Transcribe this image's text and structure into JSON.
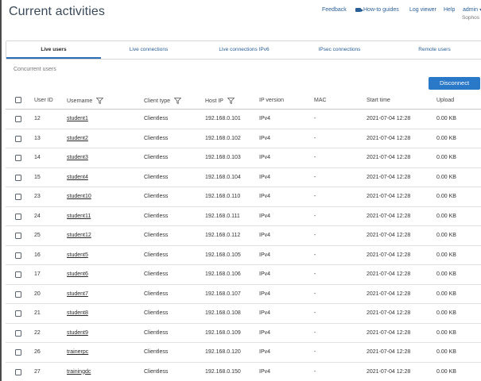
{
  "header": {
    "title": "Current activities",
    "links": {
      "feedback": "Feedback",
      "howto": "How-to guides",
      "logviewer": "Log viewer",
      "help": "Help",
      "admin": "admin"
    },
    "org": "Sophos"
  },
  "tabs": [
    {
      "label": "Live users",
      "active": true
    },
    {
      "label": "Live connections",
      "active": false
    },
    {
      "label": "Live connections IPv6",
      "active": false
    },
    {
      "label": "IPsec connections",
      "active": false
    },
    {
      "label": "Remote users",
      "active": false
    }
  ],
  "section": {
    "label": "Concurrent users"
  },
  "actions": {
    "disconnect": "Disconnect"
  },
  "columns": {
    "user_id": "User ID",
    "username": "Username",
    "client_type": "Client type",
    "host_ip": "Host IP",
    "ip_version": "IP version",
    "mac": "MAC",
    "start_time": "Start time",
    "upload": "Upload"
  },
  "rows": [
    {
      "id": "12",
      "username": "student1",
      "client": "Clientless",
      "ip": "192.168.0.101",
      "ipver": "IPv4",
      "mac": "-",
      "start": "2021-07-04 12:28",
      "upload": "0.00 KB"
    },
    {
      "id": "13",
      "username": "student2",
      "client": "Clientless",
      "ip": "192.168.0.102",
      "ipver": "IPv4",
      "mac": "-",
      "start": "2021-07-04 12:28",
      "upload": "0.00 KB"
    },
    {
      "id": "14",
      "username": "student3",
      "client": "Clientless",
      "ip": "192.168.0.103",
      "ipver": "IPv4",
      "mac": "-",
      "start": "2021-07-04 12:28",
      "upload": "0.00 KB"
    },
    {
      "id": "15",
      "username": "student4",
      "client": "Clientless",
      "ip": "192.168.0.104",
      "ipver": "IPv4",
      "mac": "-",
      "start": "2021-07-04 12:28",
      "upload": "0.00 KB"
    },
    {
      "id": "23",
      "username": "student10",
      "client": "Clientless",
      "ip": "192.168.0.110",
      "ipver": "IPv4",
      "mac": "-",
      "start": "2021-07-04 12:28",
      "upload": "0.00 KB"
    },
    {
      "id": "24",
      "username": "student11",
      "client": "Clientless",
      "ip": "192.168.0.111",
      "ipver": "IPv4",
      "mac": "-",
      "start": "2021-07-04 12:28",
      "upload": "0.00 KB"
    },
    {
      "id": "25",
      "username": "student12",
      "client": "Clientless",
      "ip": "192.168.0.112",
      "ipver": "IPv4",
      "mac": "-",
      "start": "2021-07-04 12:28",
      "upload": "0.00 KB"
    },
    {
      "id": "16",
      "username": "student5",
      "client": "Clientless",
      "ip": "192.168.0.105",
      "ipver": "IPv4",
      "mac": "-",
      "start": "2021-07-04 12:28",
      "upload": "0.00 KB"
    },
    {
      "id": "17",
      "username": "student6",
      "client": "Clientless",
      "ip": "192.168.0.106",
      "ipver": "IPv4",
      "mac": "-",
      "start": "2021-07-04 12:28",
      "upload": "0.00 KB"
    },
    {
      "id": "20",
      "username": "student7",
      "client": "Clientless",
      "ip": "192.168.0.107",
      "ipver": "IPv4",
      "mac": "-",
      "start": "2021-07-04 12:28",
      "upload": "0.00 KB"
    },
    {
      "id": "21",
      "username": "student8",
      "client": "Clientless",
      "ip": "192.168.0.108",
      "ipver": "IPv4",
      "mac": "-",
      "start": "2021-07-04 12:28",
      "upload": "0.00 KB"
    },
    {
      "id": "22",
      "username": "student9",
      "client": "Clientless",
      "ip": "192.168.0.109",
      "ipver": "IPv4",
      "mac": "-",
      "start": "2021-07-04 12:28",
      "upload": "0.00 KB"
    },
    {
      "id": "26",
      "username": "trainerpc",
      "client": "Clientless",
      "ip": "192.168.0.120",
      "ipver": "IPv4",
      "mac": "-",
      "start": "2021-07-04 12:28",
      "upload": "0.00 KB"
    },
    {
      "id": "27",
      "username": "trainingdc",
      "client": "Clientless",
      "ip": "192.168.0.150",
      "ipver": "IPv4",
      "mac": "-",
      "start": "2021-07-04 12:28",
      "upload": "0.00 KB"
    }
  ]
}
